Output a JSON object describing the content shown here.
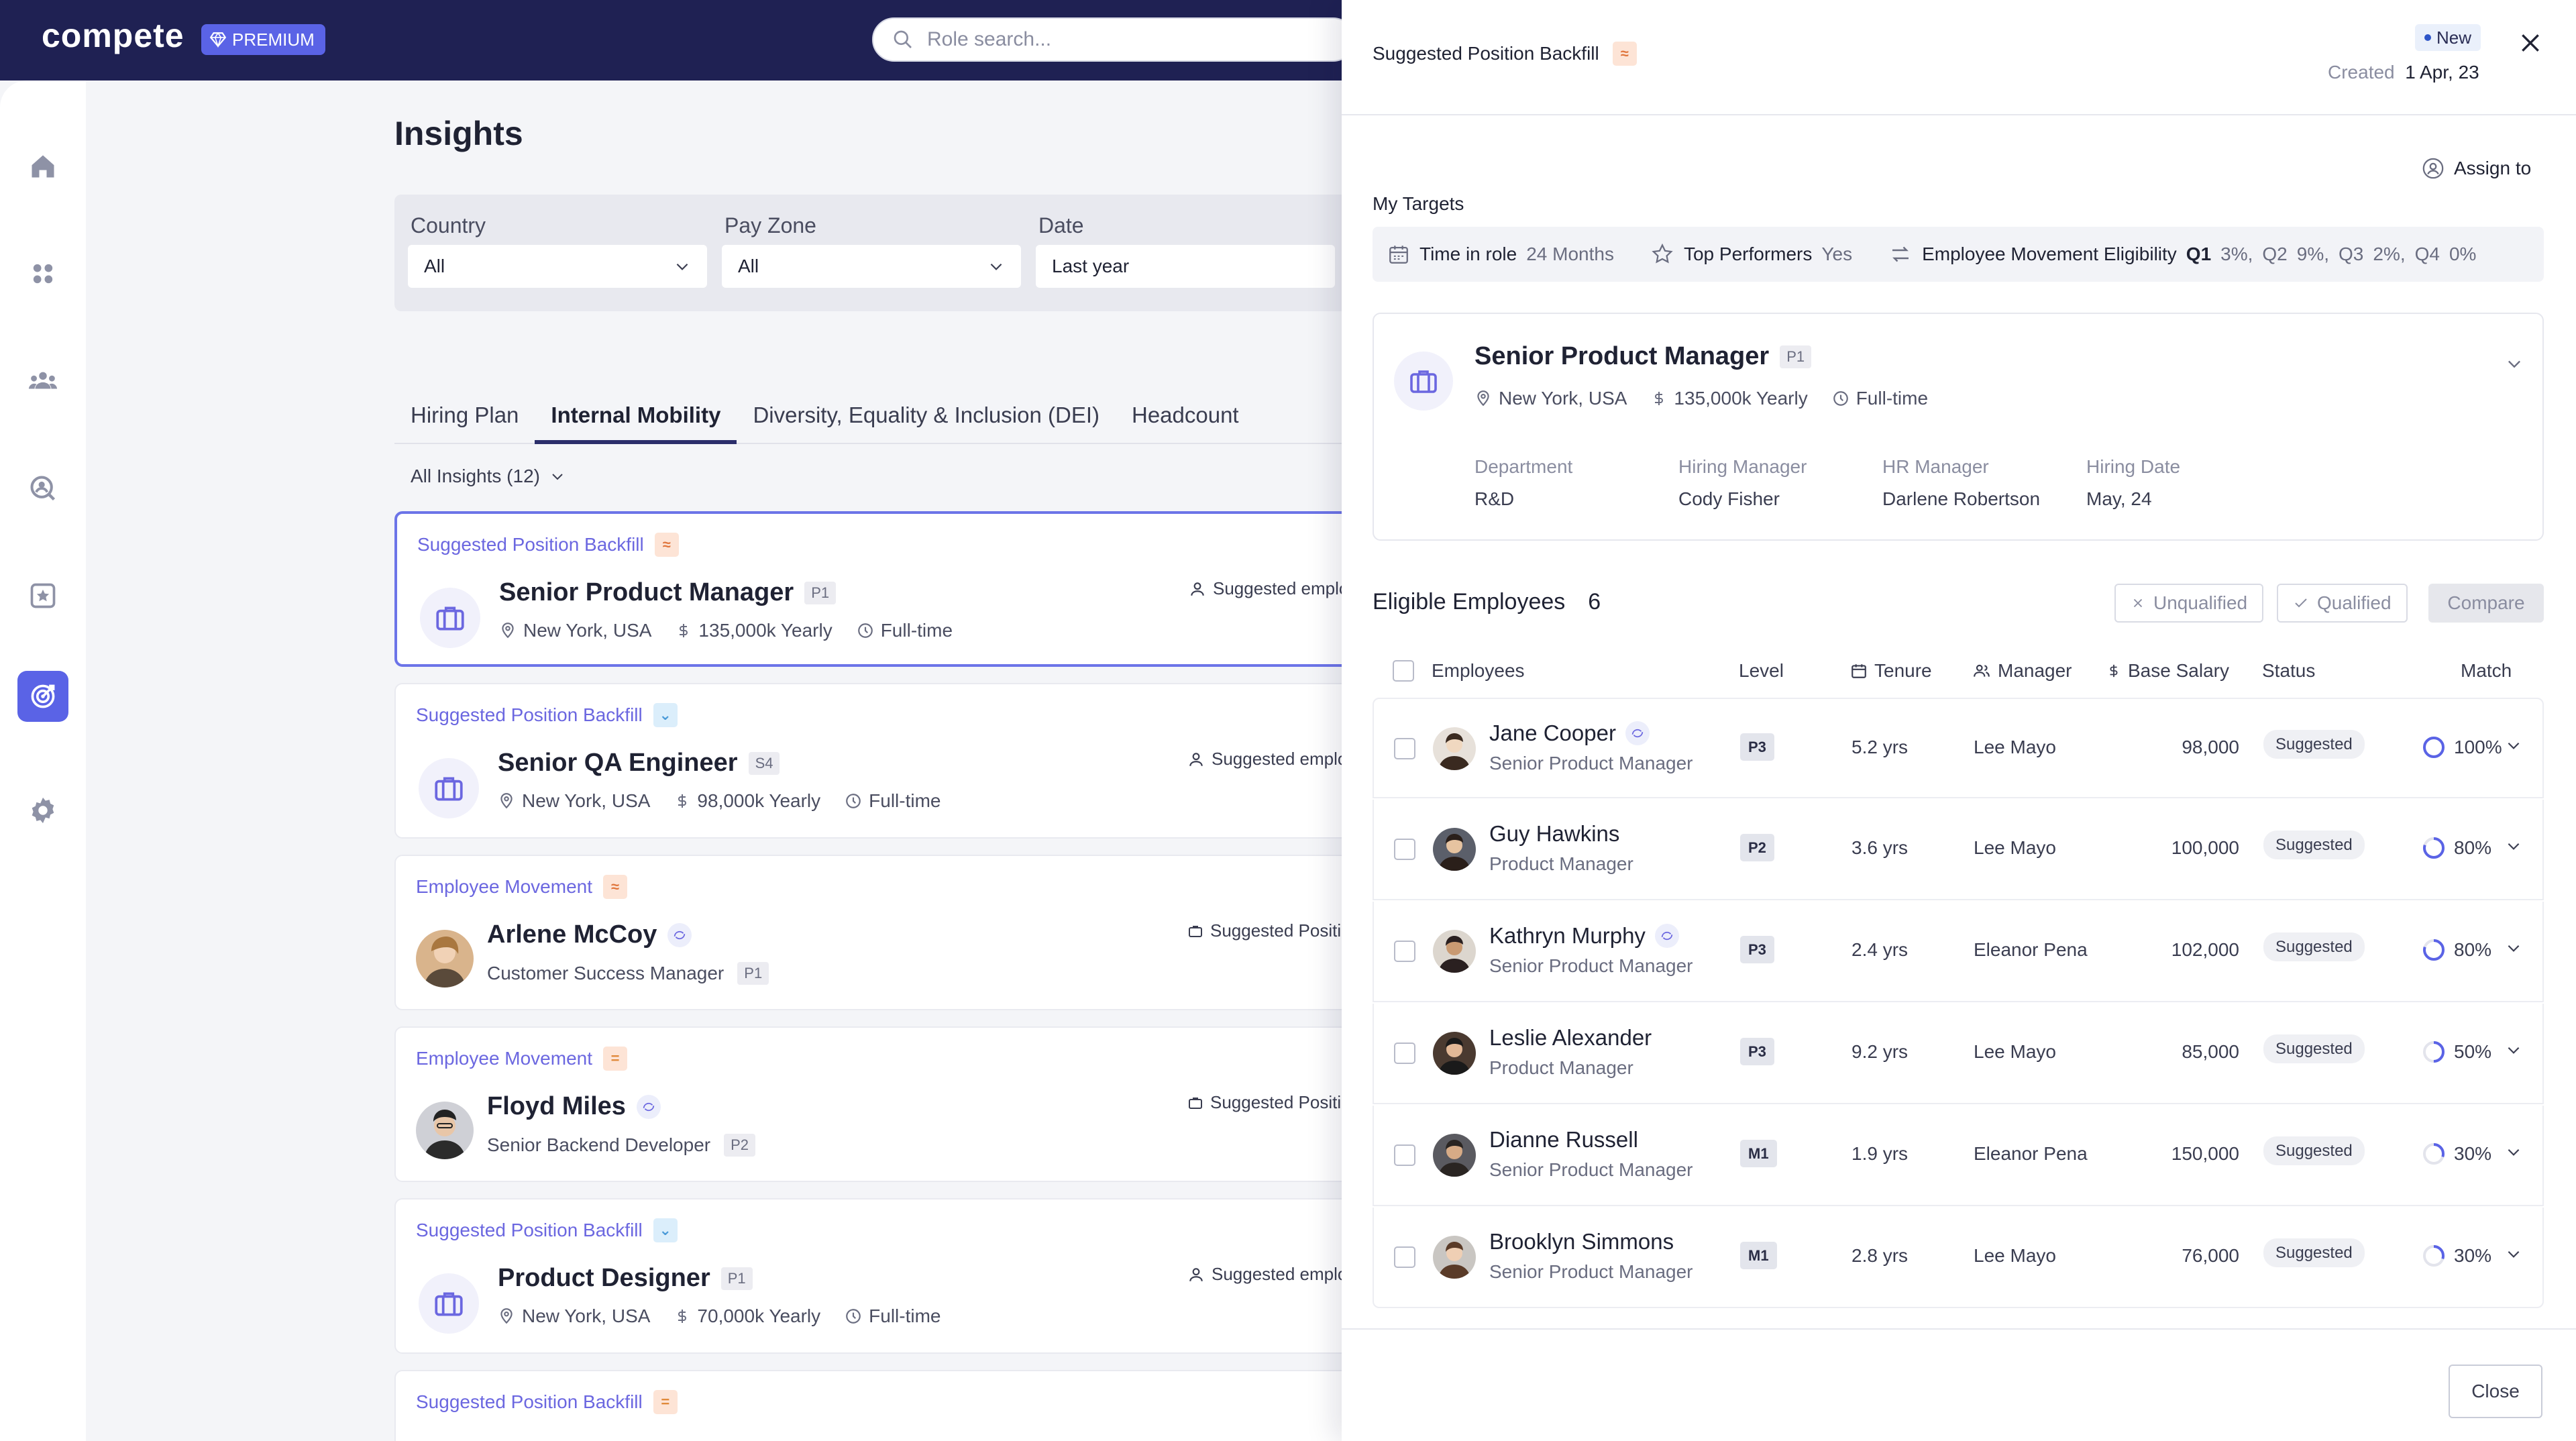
{
  "app": {
    "logo": "compete",
    "premium_label": "PREMIUM"
  },
  "search": {
    "placeholder": "Role search..."
  },
  "sidebar": {
    "items": [
      "home-icon",
      "apps-icon",
      "team-icon",
      "search-user-icon",
      "star-icon",
      "target-icon",
      "gear-icon"
    ],
    "active": "target-icon"
  },
  "page": {
    "title": "Insights"
  },
  "filters": [
    {
      "label": "Country",
      "value": "All"
    },
    {
      "label": "Pay Zone",
      "value": "All"
    },
    {
      "label": "Date",
      "value": "Last year"
    }
  ],
  "tabs": [
    {
      "label": "Hiring Plan",
      "active": false
    },
    {
      "label": "Internal Mobility",
      "active": true
    },
    {
      "label": "Diversity, Equality & Inclusion (DEI)",
      "active": false
    },
    {
      "label": "Headcount",
      "active": false
    }
  ],
  "insights_count": "All Insights  (12)",
  "cards": [
    {
      "type": "Suggested Position Backfill",
      "title": "Senior Product Manager",
      "tag": "P1",
      "location": "New York, USA",
      "salary": "135,000k Yearly",
      "schedule": "Full-time",
      "right": "Suggested employ"
    },
    {
      "type": "Suggested Position Backfill",
      "title": "Senior QA Engineer",
      "tag": "S4",
      "location": "New York, USA",
      "salary": "98,000k Yearly",
      "schedule": "Full-time",
      "right": "Suggested employ"
    },
    {
      "type": "Employee Movement",
      "title": "Arlene McCoy",
      "subtitle": "Customer Success Manager",
      "tag": "P1",
      "right": "Suggested Positio"
    },
    {
      "type": "Employee Movement",
      "title": "Floyd Miles",
      "subtitle": "Senior Backend Developer",
      "tag": "P2",
      "right": "Suggested Positio"
    },
    {
      "type": "Suggested Position Backfill",
      "title": "Product Designer",
      "tag": "P1",
      "location": "New York, USA",
      "salary": "70,000k Yearly",
      "schedule": "Full-time",
      "right": "Suggested employ"
    },
    {
      "type": "Suggested Position Backfill"
    }
  ],
  "drawer": {
    "title": "Suggested Position Backfill",
    "badge": "New",
    "created_label": "Created",
    "created_date": "1 Apr, 23",
    "assign_label": "Assign to",
    "my_targets_label": "My Targets",
    "targets": {
      "time_in_role_label": "Time in role",
      "time_in_role_value": "24 Months",
      "top_performers_label": "Top Performers",
      "top_performers_value": "Yes",
      "movement_label": "Employee Movement Eligibility",
      "quarters": [
        {
          "q": "Q1",
          "v": "3%,"
        },
        {
          "q": "Q2",
          "v": "9%,"
        },
        {
          "q": "Q3",
          "v": "2%,"
        },
        {
          "q": "Q4",
          "v": "0%"
        }
      ]
    },
    "position": {
      "title": "Senior Product Manager",
      "tag": "P1",
      "location": "New York, USA",
      "salary": "135,000k Yearly",
      "schedule": "Full-time",
      "details": [
        {
          "k": "Department",
          "v": "R&D"
        },
        {
          "k": "Hiring Manager",
          "v": "Cody Fisher"
        },
        {
          "k": "HR Manager",
          "v": "Darlene Robertson"
        },
        {
          "k": "Hiring Date",
          "v": "May, 24"
        }
      ]
    },
    "eligible_label": "Eligible Employees",
    "eligible_count": "6",
    "unqualified_label": "Unqualified",
    "qualified_label": "Qualified",
    "compare_label": "Compare",
    "columns": {
      "employees": "Employees",
      "level": "Level",
      "tenure": "Tenure",
      "manager": "Manager",
      "salary": "Base Salary",
      "status": "Status",
      "match": "Match"
    },
    "employees": [
      {
        "name": "Jane Cooper",
        "role": "Senior Product Manager",
        "level": "P3",
        "tenure": "5.2 yrs",
        "manager": "Lee Mayo",
        "salary": "98,000",
        "status": "Suggested",
        "match": "100%",
        "match_pct": 100,
        "movement_icon": true
      },
      {
        "name": "Guy Hawkins",
        "role": "Product Manager",
        "level": "P2",
        "tenure": "3.6 yrs",
        "manager": "Lee Mayo",
        "salary": "100,000",
        "status": "Suggested",
        "match": "80%",
        "match_pct": 80,
        "movement_icon": false
      },
      {
        "name": "Kathryn Murphy",
        "role": "Senior Product Manager",
        "level": "P3",
        "tenure": "2.4 yrs",
        "manager": "Eleanor Pena",
        "salary": "102,000",
        "status": "Suggested",
        "match": "80%",
        "match_pct": 80,
        "movement_icon": true
      },
      {
        "name": "Leslie Alexander",
        "role": "Product Manager",
        "level": "P3",
        "tenure": "9.2 yrs",
        "manager": "Lee Mayo",
        "salary": "85,000",
        "status": "Suggested",
        "match": "50%",
        "match_pct": 50,
        "movement_icon": false
      },
      {
        "name": "Dianne Russell",
        "role": "Senior Product Manager",
        "level": "M1",
        "tenure": "1.9 yrs",
        "manager": "Eleanor Pena",
        "salary": "150,000",
        "status": "Suggested",
        "match": "30%",
        "match_pct": 30,
        "movement_icon": false
      },
      {
        "name": "Brooklyn Simmons",
        "role": "Senior Product Manager",
        "level": "M1",
        "tenure": "2.8 yrs",
        "manager": "Lee Mayo",
        "salary": "76,000",
        "status": "Suggested",
        "match": "30%",
        "match_pct": 30,
        "movement_icon": false
      }
    ],
    "close_label": "Close"
  },
  "colors": {
    "navy": "#1f2153",
    "accent": "#5a63e6",
    "link": "#6b67e0",
    "ring": "#5a63e6"
  }
}
